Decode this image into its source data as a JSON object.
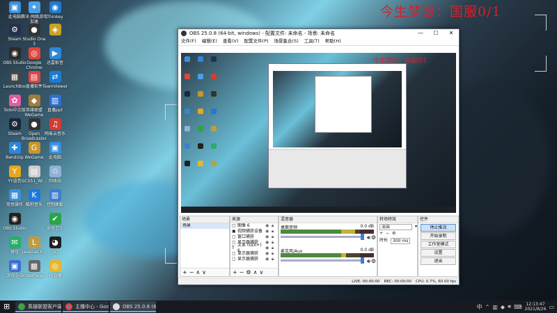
{
  "wallpaper": {
    "overlay_text": "今生梦想：国服0/1"
  },
  "desktop_icons": [
    {
      "label": "此电脑",
      "glyph": "▣",
      "color": "#3b8fd8"
    },
    {
      "label": "腾讯·网络游戏加速",
      "glyph": "✦",
      "color": "#4aa0e6"
    },
    {
      "label": "Thinkey",
      "glyph": "◉",
      "color": "#1f7bd1"
    },
    {
      "label": "Steam",
      "glyph": "⚙",
      "color": "#22324a"
    },
    {
      "label": "Studio One 3",
      "glyph": "●",
      "color": "#333"
    },
    {
      "label": "",
      "glyph": "◈",
      "color": "#c9a227"
    },
    {
      "label": "OBS Studio",
      "glyph": "◉",
      "color": "#2b2b2b"
    },
    {
      "label": "Google Chrome",
      "glyph": "◎",
      "color": "#e0473c"
    },
    {
      "label": "迅雷影音",
      "glyph": "▶",
      "color": "#2f87d8"
    },
    {
      "label": "LaunchBox",
      "glyph": "▦",
      "color": "#444"
    },
    {
      "label": "直播软件",
      "glyph": "▤",
      "color": "#d44"
    },
    {
      "label": "TeamViewer",
      "glyph": "⇄",
      "color": "#1a7bd6"
    },
    {
      "label": "Todo中文版",
      "glyph": "✿",
      "color": "#e45aa0"
    },
    {
      "label": "英雄联盟WeGame",
      "glyph": "◆",
      "color": "#a27d3a"
    },
    {
      "label": "直播ppt",
      "glyph": "▥",
      "color": "#2d6fd1"
    },
    {
      "label": "Steam",
      "glyph": "⚙",
      "color": "#1b2838"
    },
    {
      "label": "Open Broadcaster",
      "glyph": "●",
      "color": "#333"
    },
    {
      "label": "网易云音乐",
      "glyph": "♫",
      "color": "#d43c33"
    },
    {
      "label": "Bandizip",
      "glyph": "✚",
      "color": "#2f86d8"
    },
    {
      "label": "WeGame",
      "glyph": "G",
      "color": "#c8952e"
    },
    {
      "label": "此电脑",
      "glyph": "▣",
      "color": "#3a8edb"
    },
    {
      "label": "YY语音",
      "glyph": "Y",
      "color": "#e5a71d"
    },
    {
      "label": "GCS51_Wi...",
      "glyph": "▤",
      "color": "#ccc"
    },
    {
      "label": "回收站",
      "glyph": "♲",
      "color": "#8fb2d6"
    },
    {
      "label": "常用操作",
      "glyph": "▦",
      "color": "#3b8fd8"
    },
    {
      "label": "酷狗音乐",
      "glyph": "K",
      "color": "#2079d9"
    },
    {
      "label": "控制面板",
      "glyph": "▥",
      "color": "#3c7fd0"
    },
    {
      "label": "OBS Studio",
      "glyph": "◉",
      "color": "#222"
    },
    {
      "label": "",
      "glyph": "",
      "color": "transparent"
    },
    {
      "label": "安全卫士",
      "glyph": "✔",
      "color": "#2aa34a"
    },
    {
      "label": "微信",
      "glyph": "✉",
      "color": "#2aae67"
    },
    {
      "label": "LeagueCli...",
      "glyph": "L",
      "color": "#c29b3d"
    },
    {
      "label": "QQ",
      "glyph": "◕",
      "color": "#1f1f1f"
    },
    {
      "label": "游戏中心",
      "glyph": "▣",
      "color": "#3a6fd1"
    },
    {
      "label": "BroadRage...",
      "glyph": "▦",
      "color": "#666"
    },
    {
      "label": "YY直播",
      "glyph": "◎",
      "color": "#e8b62a"
    },
    {
      "label": "腾讯游戏-天涯明月",
      "glyph": "◆",
      "color": "#333"
    },
    {
      "label": "Cache G...",
      "glyph": "▦",
      "color": "#b8a23a"
    }
  ],
  "obs": {
    "title": "OBS 25.0.8 (64-bit, windows) - 配置文件: 未命名 - 场景: 未命名",
    "menu": [
      "文件(F)",
      "编辑(E)",
      "查看(V)",
      "配置文件(P)",
      "场景集合(S)",
      "工具(T)",
      "帮助(H)"
    ],
    "preview_overlay_text": "今生梦想：国服0/1",
    "panels": {
      "scenes_title": "场景",
      "sources_title": "来源",
      "mixer_title": "混音器",
      "transitions_title": "转场特效",
      "controls_title": "控件"
    },
    "scenes": [
      "场景"
    ],
    "sources": [
      {
        "glyph": "▢",
        "name": "图像 6"
      },
      {
        "glyph": "▣",
        "name": "视频捕获设备"
      },
      {
        "glyph": "▢",
        "name": "窗口捕获"
      },
      {
        "glyph": "▢",
        "name": "显示器捕获"
      },
      {
        "glyph": "T",
        "name": "文本 (GDI+) 6"
      },
      {
        "glyph": "▢",
        "name": "显示器捕获"
      },
      {
        "glyph": "▢",
        "name": "显示器捕获"
      }
    ],
    "mixer": [
      {
        "name": "桌面音频",
        "db": "0.0 dB"
      },
      {
        "name": "麦克风/Aux",
        "db": "0.0 dB"
      }
    ],
    "transition": {
      "type": "淡出",
      "duration_label": "时长",
      "duration": "300 ms"
    },
    "controls": [
      "停止推流",
      "开始录制",
      "工作室模式",
      "设置",
      "退出"
    ],
    "status": [
      "LIVE: 00:00:00",
      "REC: 00:00:00",
      "CPU: 0.7%, 60.00 fps"
    ]
  },
  "taskbar": {
    "start_glyph": "⊞",
    "items": [
      "英雄联盟客户端",
      "主播中心 - Googl...",
      "OBS 25.0.8 (64-bi..."
    ],
    "tray_lang": "中",
    "time": "12:13:47",
    "date": "2021/8/26"
  }
}
